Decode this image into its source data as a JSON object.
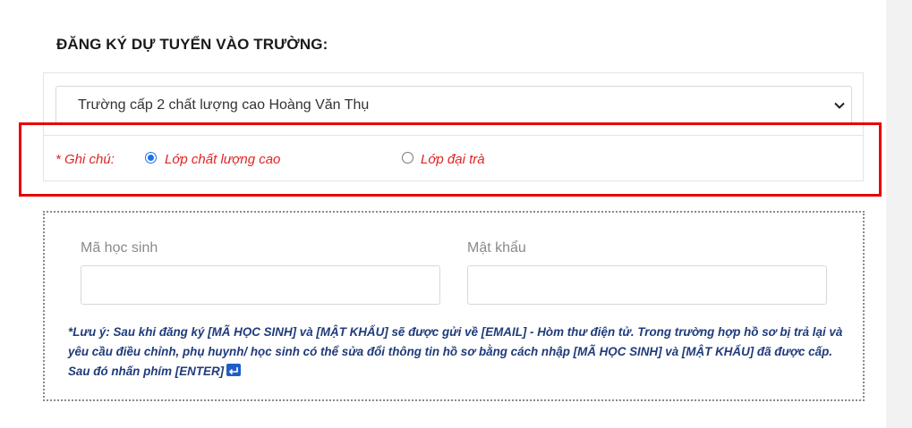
{
  "section": {
    "title": "ĐĂNG KÝ DỰ TUYỂN VÀO TRƯỜNG:"
  },
  "school_select": {
    "selected": "Trường cấp 2 chất lượng cao Hoàng Văn Thụ"
  },
  "class_type": {
    "note_label": "* Ghi chú:",
    "options": [
      {
        "label": "Lớp chất lượng cao",
        "checked": true
      },
      {
        "label": "Lớp đại trà",
        "checked": false
      }
    ]
  },
  "login": {
    "student_id_label": "Mã học sinh",
    "password_label": "Mật khẩu",
    "student_id_value": "",
    "password_value": "",
    "notice": "*Lưu ý: Sau khi đăng ký [MÃ HỌC SINH] và [MẬT KHẨU] sẽ được gửi về [EMAIL] - Hòm thư điện tử. Trong trường hợp hồ sơ bị trả lại và yêu cầu điều chỉnh, phụ huynh/ học sinh có thể sửa đổi thông tin hồ sơ bằng cách nhập [MÃ HỌC SINH] và [MẬT KHẨU] đã được cấp. Sau đó nhấn phím [ENTER]"
  },
  "colors": {
    "note_red": "#e02424",
    "highlight_red": "#e60000",
    "notice_blue": "#1f3b7a",
    "radio_blue": "#1a73e8"
  },
  "icons": {
    "enter_key": "enter-key-icon",
    "dropdown": "chevron-down-icon"
  }
}
